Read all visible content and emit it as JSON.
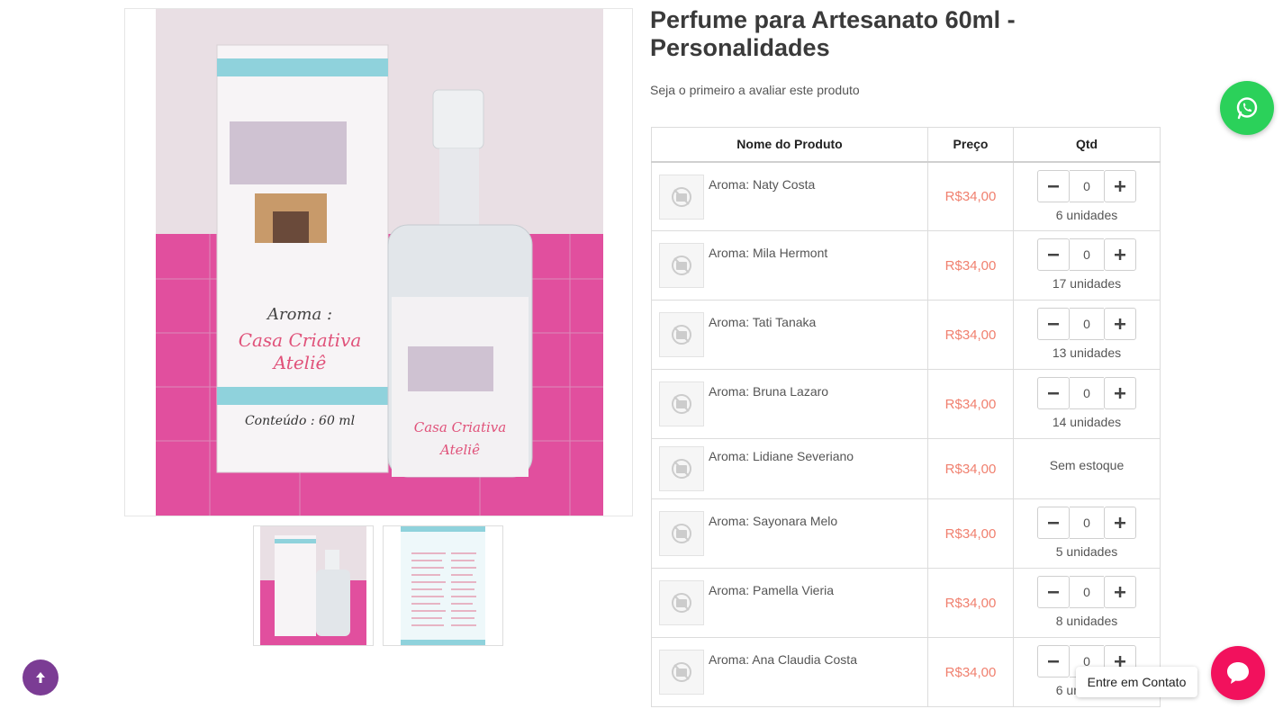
{
  "product": {
    "title": "Perfume para Artesanato 60ml - Personalidades",
    "rating_text": "Seja o primeiro a avaliar este produto",
    "image_label_box": "Aroma :",
    "image_label_brand": "Casa Criativa Ateliê",
    "image_label_content": "Conteúdo : 60 ml",
    "thumbnails": [
      "thumbnail-perfume",
      "thumbnail-aroma-list"
    ]
  },
  "table": {
    "headers": {
      "name": "Nome do Produto",
      "price": "Preço",
      "qty": "Qtd"
    },
    "rows": [
      {
        "name": "Aroma: Naty Costa",
        "price": "R$34,00",
        "qty": "0",
        "stock": "6 unidades"
      },
      {
        "name": "Aroma: Mila Hermont",
        "price": "R$34,00",
        "qty": "0",
        "stock": "17 unidades"
      },
      {
        "name": "Aroma: Tati Tanaka",
        "price": "R$34,00",
        "qty": "0",
        "stock": "13 unidades"
      },
      {
        "name": "Aroma: Bruna Lazaro",
        "price": "R$34,00",
        "qty": "0",
        "stock": "14 unidades"
      },
      {
        "name": "Aroma: Lidiane Severiano",
        "price": "R$34,00",
        "stock_status": "Sem estoque"
      },
      {
        "name": "Aroma: Sayonara Melo",
        "price": "R$34,00",
        "qty": "0",
        "stock": "5 unidades"
      },
      {
        "name": "Aroma: Pamella Vieria",
        "price": "R$34,00",
        "qty": "0",
        "stock": "8 unidades"
      },
      {
        "name": "Aroma: Ana Claudia Costa",
        "price": "R$34,00",
        "qty": "0",
        "stock": "6 unidades"
      }
    ]
  },
  "widgets": {
    "contact_tooltip": "Entre em Contato",
    "whatsapp_icon": "whatsapp-icon",
    "scroll_top_icon": "arrow-up-icon",
    "chat_icon": "chat-bubble-icon"
  },
  "colors": {
    "price": "#f0806f",
    "whatsapp": "#2bd15a",
    "scroll_top": "#7b3c94",
    "chat": "#f2115d"
  }
}
